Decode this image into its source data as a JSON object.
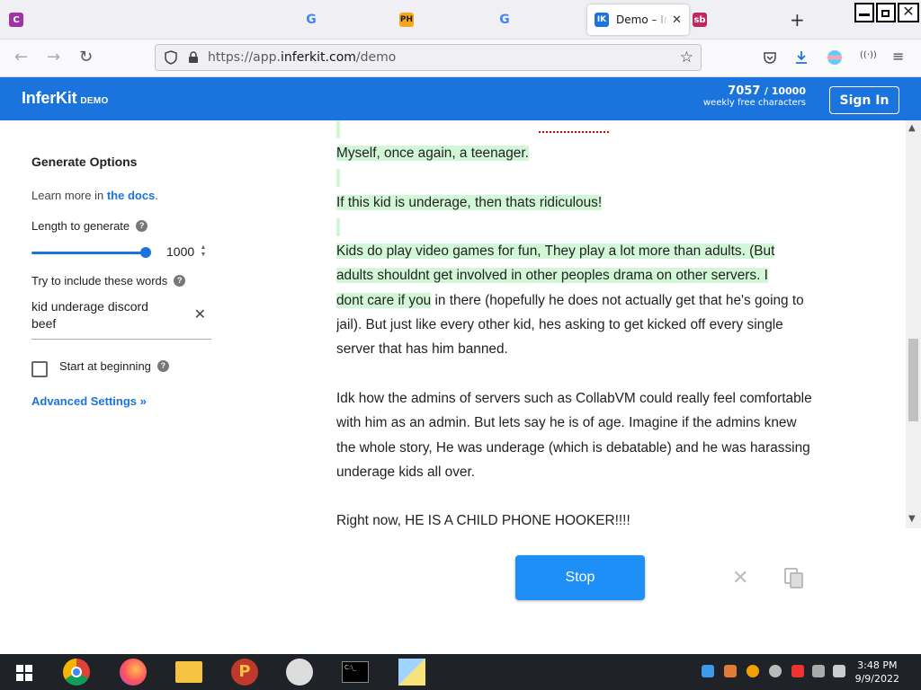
{
  "browser": {
    "tabs": [
      {
        "favicon_letter": "C",
        "color": "#a034a6",
        "title": ""
      },
      {
        "favicon_letter": "G",
        "color": "#ffffff",
        "title": ""
      },
      {
        "favicon_letter": "PH",
        "color": "#f5a623",
        "title": ""
      },
      {
        "favicon_letter": "G",
        "color": "#ffffff",
        "title": ""
      },
      {
        "favicon_letter": "IK",
        "color": "#1b74dd",
        "title": "Demo – InferKit"
      },
      {
        "favicon_letter": "sb",
        "color": "#c0295e",
        "title": ""
      }
    ],
    "url_prefix": "https://app.",
    "url_domain": "inferkit.com",
    "url_path": "/demo"
  },
  "header": {
    "logo": "InferKit",
    "logo_badge": "DEMO",
    "credits_used": "7057",
    "credits_total": "/ 10000",
    "credits_label": "weekly free characters",
    "signin_label": "Sign In"
  },
  "sidebar": {
    "title": "Generate Options",
    "learn_more_prefix": "Learn more in ",
    "learn_more_link": "the docs",
    "learn_more_suffix": ".",
    "length_label": "Length to generate",
    "length_value": "1000",
    "length_fraction": 0.96,
    "words_label": "Try to include these words",
    "words_value": "kid underage discord beef",
    "start_label": "Start at beginning",
    "start_checked": false,
    "advanced_label": "Advanced Settings »"
  },
  "content": {
    "para1": "Myself, once again, a teenager.",
    "para2": "If this kid is underage, then thats ridiculous!",
    "para3_highlighted_a": "Kids do play video games for fun, They play a lot more than adults. (But",
    "para3_highlighted_b": "adults shouldnt get involved in other peoples drama on other servers. I",
    "para3_highlighted_c": "dont care if you",
    "para3_rest": " in there (hopefully he does not actually get that he's going to jail). But just like every other kid, hes asking to get kicked off every single server that has him banned.",
    "para4": "Idk how the admins of servers such as CollabVM could really feel comfortable with him as an admin. But lets say he is of age. Imagine if the admins knew the whole story, He was underage (which is debatable) and he was harassing underage kids all over.",
    "para5": "Right now, HE IS A CHILD PHONE HOOKER!!!!"
  },
  "actions": {
    "stop_label": "Stop"
  },
  "taskbar": {
    "time": "3:48 PM",
    "date": "9/9/2022"
  },
  "colors": {
    "brand_blue": "#1b74dd",
    "highlight_green": "#d2f7d6",
    "stop_blue": "#1e8ff7"
  }
}
